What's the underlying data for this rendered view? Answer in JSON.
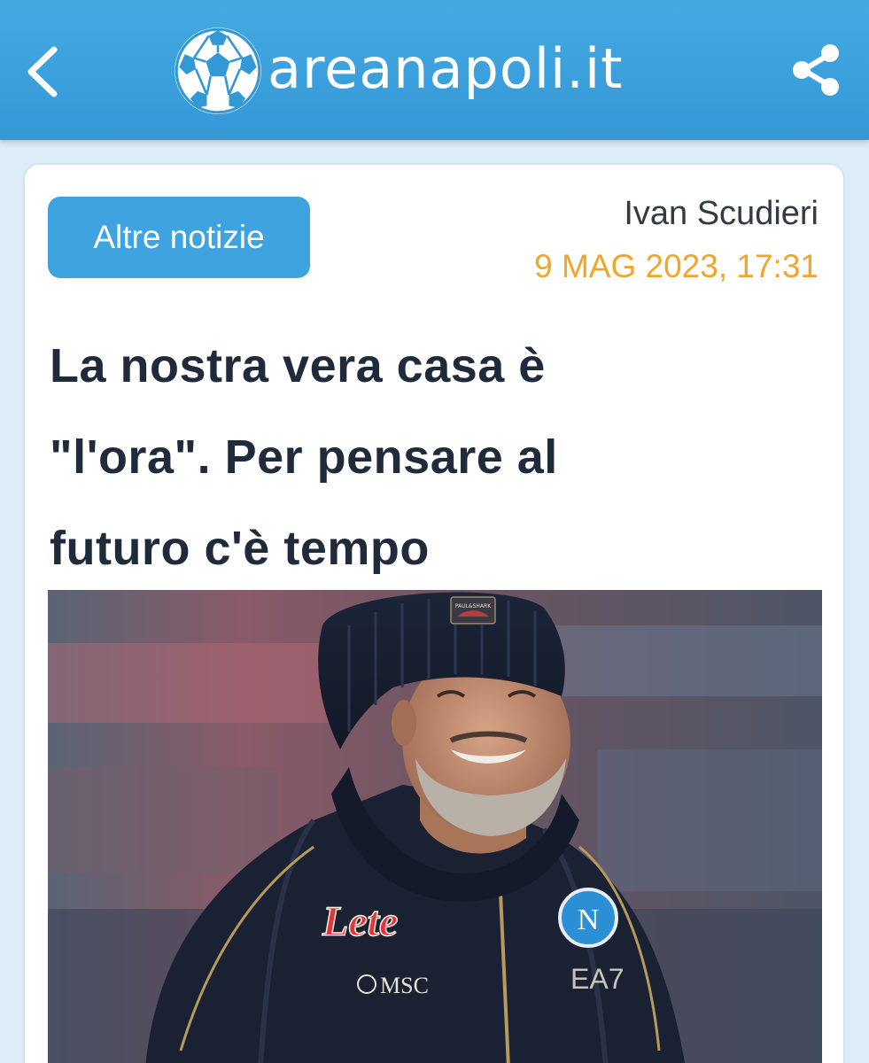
{
  "header": {
    "site_name": "areanapoli.it",
    "back_icon": "chevron-left-icon",
    "share_icon": "share-icon",
    "logo_icon": "soccer-ball-icon",
    "background_color": "#3a9fdc"
  },
  "article": {
    "category_button": "Altre notizie",
    "author": "Ivan Scudieri",
    "date": "9 MAG 2023, 17:31",
    "headline_lines": [
      "La nostra vera casa è",
      "\"l'ora\". Per pensare al",
      "futuro c'è tempo"
    ],
    "photo": {
      "jacket_sponsor": "Lete",
      "jacket_sponsor_secondary": "MSC",
      "jacket_brand": "EA7",
      "crest_letter": "N",
      "hat_badge": "PAUL&SHARK"
    }
  },
  "colors": {
    "accent": "#3fa3e0",
    "date": "#f0a52b",
    "headline": "#1f2a3a",
    "page_background": "#dcedf8"
  }
}
